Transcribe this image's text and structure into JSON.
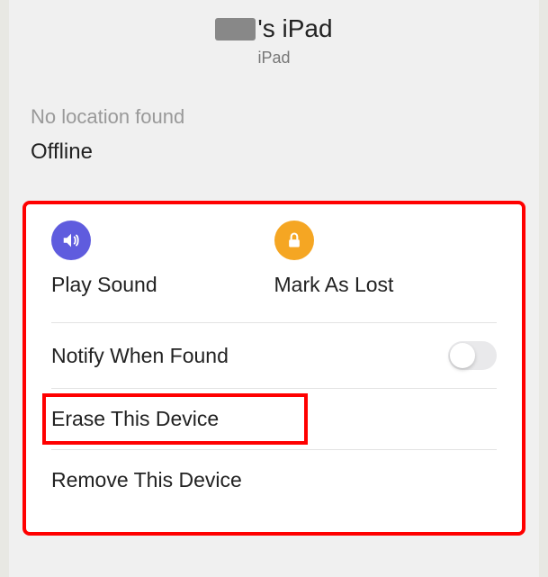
{
  "header": {
    "title_suffix": "'s iPad",
    "device_type": "iPad"
  },
  "status": {
    "label": "No location found",
    "value": "Offline"
  },
  "actions": {
    "play_sound": "Play Sound",
    "mark_lost": "Mark As Lost"
  },
  "rows": {
    "notify": "Notify When Found",
    "erase": "Erase This Device",
    "remove": "Remove This Device"
  },
  "colors": {
    "play_icon": "#5f5cde",
    "lost_icon": "#f5a623",
    "highlight": "#f00"
  }
}
